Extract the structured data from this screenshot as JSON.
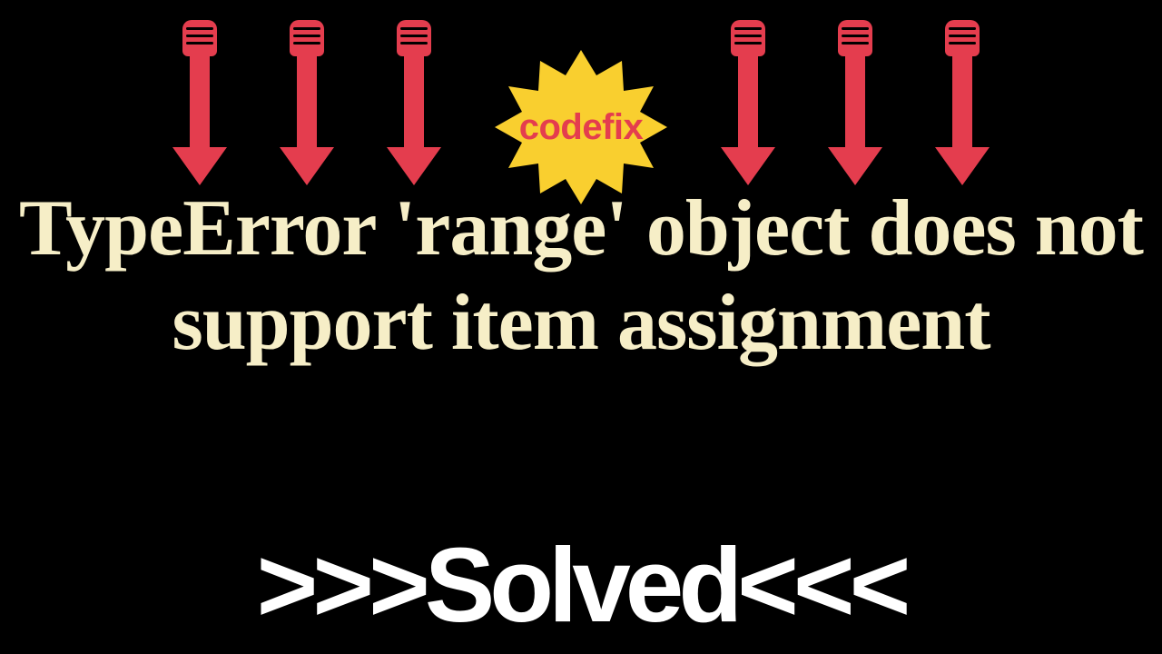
{
  "badge": {
    "label": "codefix",
    "fill": "#f9cf2f",
    "text_color": "#e43d4e"
  },
  "title": {
    "text": "TypeError 'range' object does not support item assignment",
    "color": "#f6eec7"
  },
  "solved": {
    "prefix": ">>>",
    "word": "Solved",
    "suffix": "<<<",
    "color": "#ffffff"
  },
  "arrows": {
    "color": "#e43d4e",
    "count_left": 3,
    "count_right": 3
  }
}
